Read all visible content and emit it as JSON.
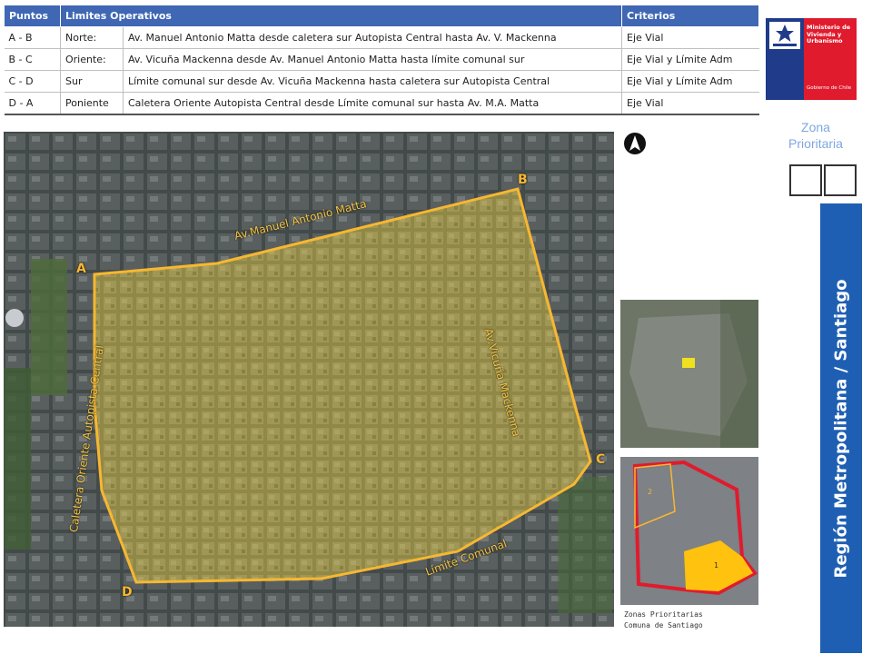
{
  "table": {
    "headers": [
      "Puntos",
      "Limites Operativos",
      "",
      "Criterios"
    ],
    "rows": [
      {
        "points": "A - B",
        "side": "Norte:",
        "limit": "Av. Manuel Antonio Matta desde caletera sur Autopista Central hasta Av. V. Mackenna",
        "criteria": "Eje Vial"
      },
      {
        "points": "B - C",
        "side": "Oriente:",
        "limit": "Av. Vicuña Mackenna desde Av. Manuel Antonio Matta hasta límite comunal sur",
        "criteria": "Eje Vial y Límite Adm"
      },
      {
        "points": "C - D",
        "side": "Sur",
        "limit": "Límite comunal sur desde Av. Vicuña Mackenna hasta caletera sur Autopista Central",
        "criteria": "Eje Vial y Límite Adm"
      },
      {
        "points": "D - A",
        "side": "Poniente",
        "limit": "Caletera Oriente Autopista Central desde Límite comunal sur hasta Av. M.A. Matta",
        "criteria": "Eje Vial"
      }
    ]
  },
  "logo": {
    "ministry": "Ministerio de Vivienda y Urbanismo",
    "government": "Gobierno de Chile"
  },
  "zone_label": "Zona Prioritaria",
  "region_title": "Región Metropolitana / Santiago",
  "map": {
    "street_north": "Av.Manuel Antonio Matta",
    "street_east": "Av.Vicuña Mackenna",
    "street_west": "Caletera Oriente Autopista Central",
    "street_south": "Límite Comunal",
    "points": {
      "a": "A",
      "b": "B",
      "c": "C",
      "d": "D"
    }
  },
  "inset": {
    "zone_1": "1",
    "zone_2": "2",
    "caption_line1": "Zonas Prioritarias",
    "caption_line2": "Comuna de Santiago"
  },
  "colors": {
    "header_blue": "#3f67b3",
    "region_blue": "#1f5fb3",
    "zone_fill": "#c9b43a",
    "boundary_orange": "#f7b731",
    "commune_red": "#e01b2d"
  },
  "icons": {
    "north": "north-arrow-icon",
    "crest": "chile-crest-icon"
  }
}
